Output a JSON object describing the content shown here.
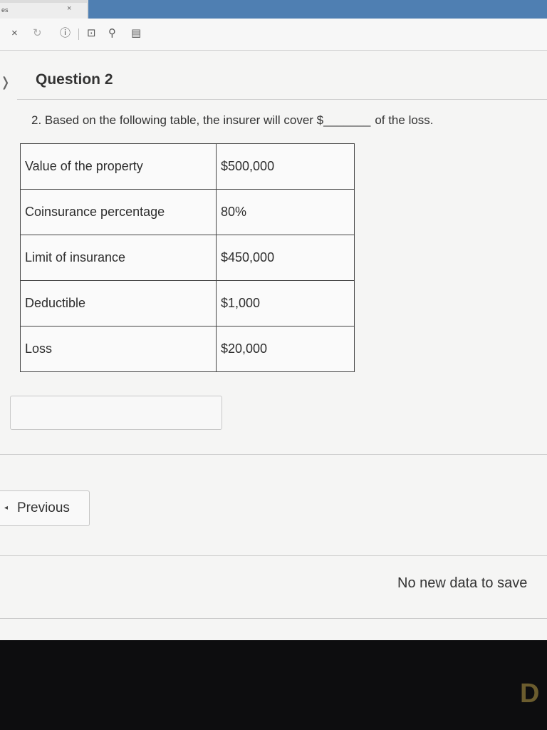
{
  "browser": {
    "tab_text": "es",
    "tab_close": "×",
    "toolbar_icons": [
      "close-icon",
      "reload-icon",
      "info-icon",
      "bookmark-icon",
      "search-icon",
      "calculator-icon"
    ],
    "glyphs": {
      "close": "×",
      "reload": "↻",
      "info": "ⓘ",
      "bookmark": "⊡",
      "search": "⚲",
      "calc": "▤"
    }
  },
  "question": {
    "back_glyph": "❭",
    "title": "Question 2",
    "text": "2. Based on the following table, the insurer will cover $_______",
    "text_suffix": "of the loss."
  },
  "table": {
    "rows": [
      {
        "label": "Value of the property",
        "value": "$500,000"
      },
      {
        "label": "Coinsurance percentage",
        "value": "80%"
      },
      {
        "label": "Limit of insurance",
        "value": "$450,000"
      },
      {
        "label": "Deductible",
        "value": "$1,000"
      },
      {
        "label": "Loss",
        "value": "$20,000"
      }
    ]
  },
  "answer": {
    "value": ""
  },
  "nav": {
    "previous_caret": "◂",
    "previous_label": "Previous"
  },
  "status": {
    "save_text": "No new data to save"
  },
  "corner_glyph": "D"
}
